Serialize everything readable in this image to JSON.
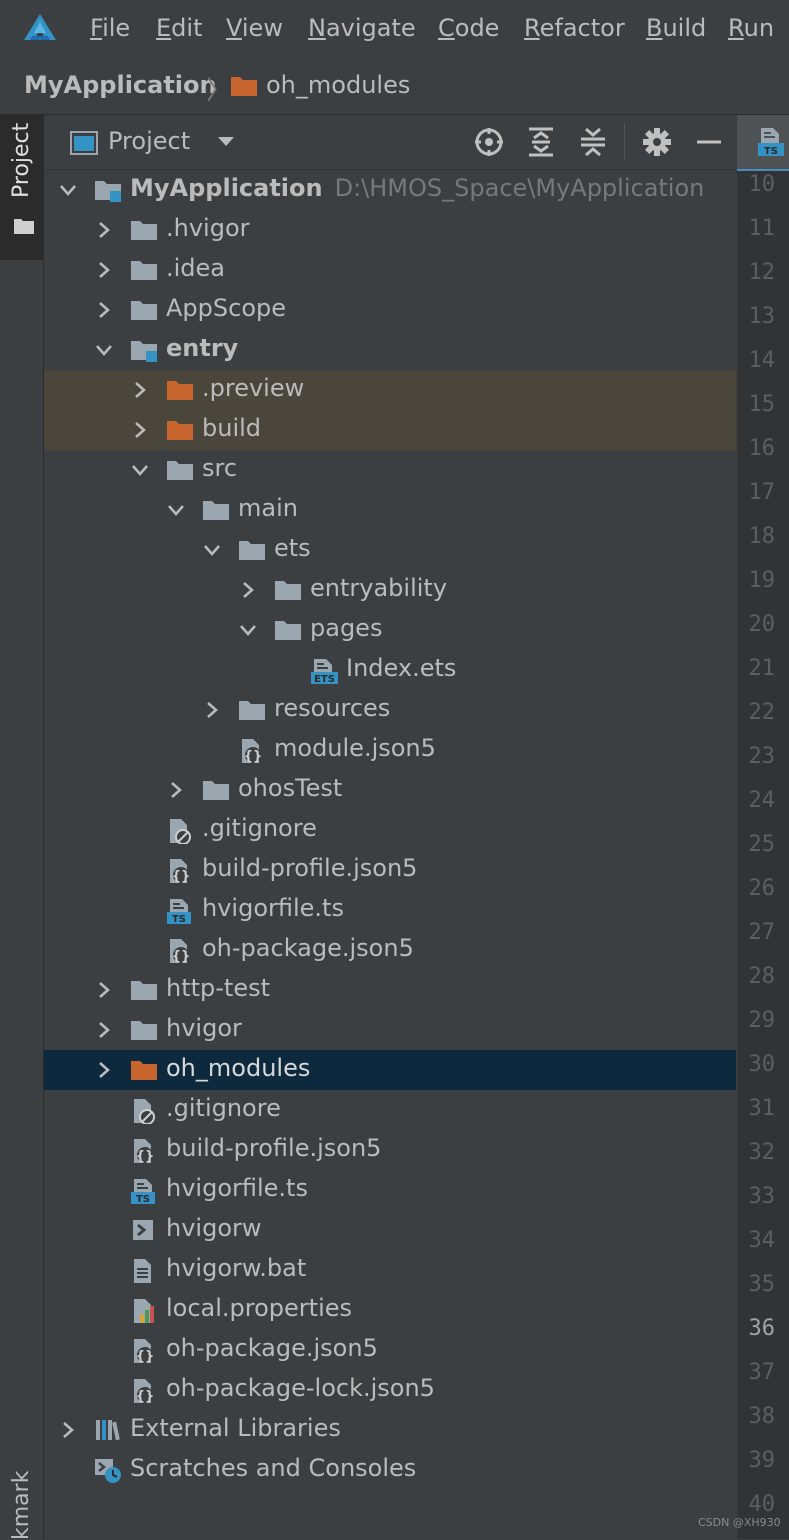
{
  "menubar": {
    "logo_icon": "deveco-logo-icon",
    "items": [
      {
        "mnemonic": "F",
        "rest": "ile"
      },
      {
        "mnemonic": "E",
        "rest": "dit"
      },
      {
        "mnemonic": "V",
        "rest": "iew"
      },
      {
        "mnemonic": "N",
        "rest": "avigate"
      },
      {
        "mnemonic": "C",
        "rest": "ode"
      },
      {
        "mnemonic": "R",
        "rest": "efactor"
      },
      {
        "mnemonic": "B",
        "rest": "uild"
      },
      {
        "mnemonic": "R",
        "rest": "un"
      }
    ]
  },
  "breadcrumb": {
    "root": "MyApplication",
    "separator": "〉",
    "leaf": "oh_modules"
  },
  "left_strip": {
    "project_tab": "Project",
    "bottom_tab": "kmarks"
  },
  "project_panel": {
    "title": "Project",
    "header_buttons": [
      "locate-icon",
      "expand-all-icon",
      "collapse-all-icon",
      "gear-icon",
      "hide-icon"
    ]
  },
  "tree": [
    {
      "label": "MyApplication",
      "path": "D:\\HMOS_Space\\MyApplication",
      "icon": "module-folder-icon",
      "expanded": true
    },
    {
      "label": ".hvigor",
      "icon": "folder-icon"
    },
    {
      "label": ".idea",
      "icon": "folder-icon"
    },
    {
      "label": "AppScope",
      "icon": "folder-icon"
    },
    {
      "label": "entry",
      "icon": "module-folder-icon",
      "expanded": true
    },
    {
      "label": ".preview",
      "icon": "excluded-folder-icon"
    },
    {
      "label": "build",
      "icon": "excluded-folder-icon"
    },
    {
      "label": "src",
      "icon": "folder-icon",
      "expanded": true
    },
    {
      "label": "main",
      "icon": "folder-icon",
      "expanded": true
    },
    {
      "label": "ets",
      "icon": "folder-icon",
      "expanded": true
    },
    {
      "label": "entryability",
      "icon": "folder-icon"
    },
    {
      "label": "pages",
      "icon": "folder-icon",
      "expanded": true
    },
    {
      "label": "Index.ets",
      "icon": "ets-file-icon"
    },
    {
      "label": "resources",
      "icon": "folder-icon"
    },
    {
      "label": "module.json5",
      "icon": "json5-file-icon"
    },
    {
      "label": "ohosTest",
      "icon": "folder-icon"
    },
    {
      "label": ".gitignore",
      "icon": "gitignore-file-icon"
    },
    {
      "label": "build-profile.json5",
      "icon": "json5-file-icon"
    },
    {
      "label": "hvigorfile.ts",
      "icon": "ts-file-icon"
    },
    {
      "label": "oh-package.json5",
      "icon": "json5-file-icon"
    },
    {
      "label": "http-test",
      "icon": "folder-icon"
    },
    {
      "label": "hvigor",
      "icon": "folder-icon"
    },
    {
      "label": "oh_modules",
      "icon": "excluded-folder-icon",
      "selected": true
    },
    {
      "label": ".gitignore",
      "icon": "gitignore-file-icon"
    },
    {
      "label": "build-profile.json5",
      "icon": "json5-file-icon"
    },
    {
      "label": "hvigorfile.ts",
      "icon": "ts-file-icon"
    },
    {
      "label": "hvigorw",
      "icon": "shell-file-icon"
    },
    {
      "label": "hvigorw.bat",
      "icon": "text-file-icon"
    },
    {
      "label": "local.properties",
      "icon": "properties-file-icon"
    },
    {
      "label": "oh-package.json5",
      "icon": "json5-file-icon"
    },
    {
      "label": "oh-package-lock.json5",
      "icon": "json5-file-icon"
    },
    {
      "label": "External Libraries",
      "icon": "libraries-icon"
    },
    {
      "label": "Scratches and Consoles",
      "icon": "scratches-icon"
    }
  ],
  "editor_gutter": {
    "tab_icon": "ts-file-icon",
    "line_numbers": [
      "10",
      "11",
      "12",
      "13",
      "14",
      "15",
      "16",
      "17",
      "18",
      "19",
      "20",
      "21",
      "22",
      "23",
      "24",
      "25",
      "26",
      "27",
      "28",
      "29",
      "30",
      "31",
      "32",
      "33",
      "34",
      "35",
      "36",
      "37",
      "38",
      "39",
      "40"
    ],
    "current_line": "36"
  },
  "watermark": "CSDN @XH930",
  "colors": {
    "background": "#3c3f41",
    "selection": "#0d293e",
    "excluded_row": "#4b463b",
    "excluded_folder": "#c9662f",
    "folder": "#9aa7b0",
    "accent_blue": "#3592c4",
    "gutter": "#313335"
  }
}
